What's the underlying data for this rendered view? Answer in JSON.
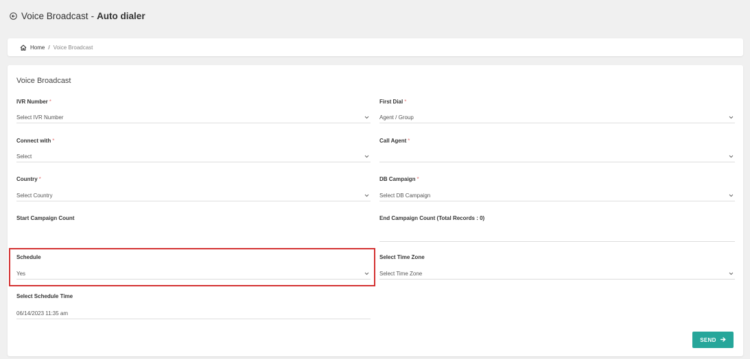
{
  "header": {
    "title_main": "Voice Broadcast",
    "title_sep": "-",
    "title_bold": "Auto dialer"
  },
  "breadcrumb": {
    "home": "Home",
    "separator": "/",
    "current": "Voice Broadcast"
  },
  "form": {
    "title": "Voice Broadcast",
    "required_mark": "*",
    "ivr_number": {
      "label": "IVR Number",
      "value": "Select IVR Number"
    },
    "first_dial": {
      "label": "First Dial",
      "value": "Agent / Group"
    },
    "connect_with": {
      "label": "Connect with",
      "value": "Select"
    },
    "call_agent": {
      "label": "Call Agent",
      "value": ""
    },
    "country": {
      "label": "Country",
      "value": "Select Country"
    },
    "db_campaign": {
      "label": "DB Campaign",
      "value": "Select DB Campaign"
    },
    "start_campaign_count": {
      "label": "Start Campaign Count",
      "value": ""
    },
    "end_campaign_count": {
      "label": "End Campaign Count (Total Records : 0)",
      "value": ""
    },
    "schedule": {
      "label": "Schedule",
      "value": "Yes"
    },
    "time_zone": {
      "label": "Select Time Zone",
      "value": "Select Time Zone"
    },
    "schedule_time": {
      "label": "Select Schedule Time",
      "value": "06/14/2023 11:35 am"
    },
    "send_label": "SEND"
  },
  "colors": {
    "accent": "#26a69a",
    "highlight": "#d32f2f",
    "required": "#e57373"
  }
}
